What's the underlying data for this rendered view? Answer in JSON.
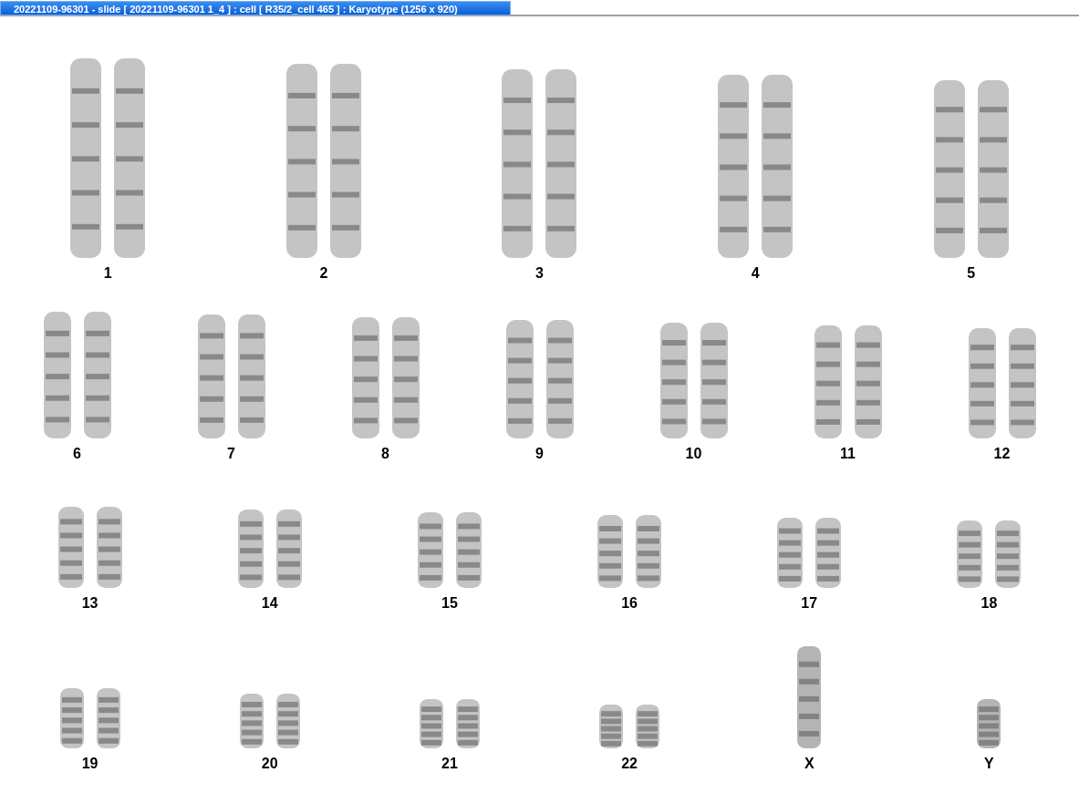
{
  "window": {
    "title": "20221109-96301 - slide [ 20221109-96301 1_4 ] : cell [ R35/2_cell 465 ] : Karyotype  (1256 x 920)"
  },
  "karyotype_rows": [
    {
      "items": [
        {
          "label": "1",
          "kind": "pair"
        },
        {
          "label": "2",
          "kind": "pair"
        },
        {
          "label": "3",
          "kind": "pair"
        },
        {
          "label": "4",
          "kind": "pair"
        },
        {
          "label": "5",
          "kind": "pair"
        }
      ]
    },
    {
      "items": [
        {
          "label": "6",
          "kind": "pair"
        },
        {
          "label": "7",
          "kind": "pair"
        },
        {
          "label": "8",
          "kind": "pair"
        },
        {
          "label": "9",
          "kind": "pair"
        },
        {
          "label": "10",
          "kind": "pair"
        },
        {
          "label": "11",
          "kind": "pair"
        },
        {
          "label": "12",
          "kind": "pair"
        }
      ]
    },
    {
      "items": [
        {
          "label": "13",
          "kind": "pair"
        },
        {
          "label": "14",
          "kind": "pair"
        },
        {
          "label": "15",
          "kind": "pair"
        },
        {
          "label": "16",
          "kind": "pair"
        },
        {
          "label": "17",
          "kind": "pair"
        },
        {
          "label": "18",
          "kind": "pair"
        }
      ]
    },
    {
      "items": [
        {
          "label": "19",
          "kind": "pair"
        },
        {
          "label": "20",
          "kind": "pair"
        },
        {
          "label": "21",
          "kind": "pair"
        },
        {
          "label": "22",
          "kind": "pair"
        },
        {
          "label": "X",
          "kind": "single"
        },
        {
          "label": "Y",
          "kind": "single"
        }
      ]
    }
  ]
}
